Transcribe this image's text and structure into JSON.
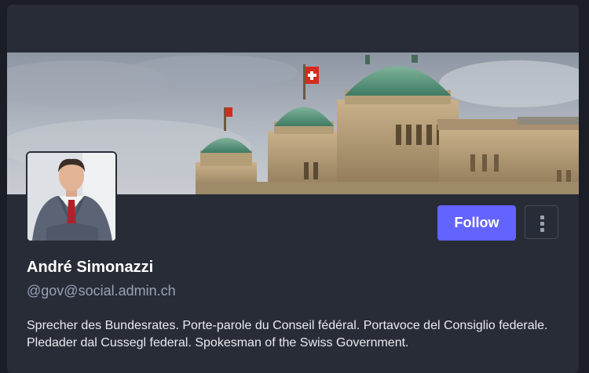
{
  "profile": {
    "display_name": "André Simonazzi",
    "handle": "@gov@social.admin.ch",
    "bio": "Sprecher des Bundesrates. Porte-parole du Conseil fédéral. Portavoce del Consiglio federale. Pledader dal Cussegl federal. Spokesman of the Swiss Government."
  },
  "actions": {
    "follow_label": "Follow",
    "menu_icon": "vertical-ellipsis-icon"
  },
  "colors": {
    "background": "#1b1e26",
    "card": "#282c37",
    "accent": "#6364ff",
    "handle_text": "#9ba1b8",
    "name_text": "#ffffff"
  },
  "images": {
    "banner": "federal-palace-bern-banner",
    "avatar": "portrait-man-in-suit"
  }
}
